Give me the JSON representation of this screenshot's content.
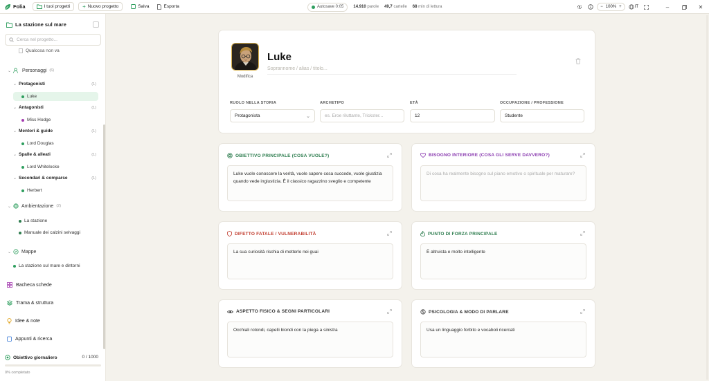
{
  "app": {
    "name": "Folia",
    "accent": "#2e9e5e"
  },
  "toolbar": {
    "my_projects": "I tuoi progetti",
    "new_project": "Nuovo progetto",
    "save": "Salva",
    "export": "Esporta",
    "autosave": "Autosave 0:05",
    "words_value": "14.910",
    "words_label": "parole",
    "pages_value": "49,7",
    "pages_label": "cartelle",
    "read_value": "68",
    "read_label": "min di lettura",
    "zoom": "100%",
    "lang": "IT"
  },
  "sidebar": {
    "project_title": "La stazione sul mare",
    "search_placeholder": "Cerca nel progetto...",
    "top_item": "Qualcosa non va",
    "characters": {
      "label": "Personaggi",
      "count": "(6)"
    },
    "groups": [
      {
        "label": "Protagonisti",
        "count": "(1)",
        "items": [
          {
            "label": "Luke",
            "color": "#2e9e5e"
          }
        ]
      },
      {
        "label": "Antagonisti",
        "count": "(1)",
        "items": [
          {
            "label": "Miss Hodge",
            "color": "#a43bb0"
          }
        ]
      },
      {
        "label": "Mentori & guide",
        "count": "(1)",
        "items": [
          {
            "label": "Lord Douglas",
            "color": "#2e9e5e"
          }
        ]
      },
      {
        "label": "Spalle & alleati",
        "count": "(1)",
        "items": [
          {
            "label": "Lord Whitelocke",
            "color": "#2e9e5e"
          }
        ]
      },
      {
        "label": "Secondari & comparse",
        "count": "(1)",
        "items": [
          {
            "label": "Herbert",
            "color": "#2e9e5e"
          }
        ]
      }
    ],
    "setting": {
      "label": "Ambientazione",
      "count": "(2)",
      "items": [
        "La stazione",
        "Manuale dei calzini selvaggi"
      ]
    },
    "maps": {
      "label": "Mappe",
      "items": [
        "La stazione sul mare e dintorni"
      ]
    },
    "nav": [
      "Bacheca schede",
      "Trama & struttura",
      "Idee & note",
      "Appunti & ricerca"
    ],
    "goal": {
      "label": "Obiettivo giornaliero",
      "value": "0 / 1000",
      "progress": 0,
      "percent_label": "0% completato"
    }
  },
  "character": {
    "name": "Luke",
    "nickname_placeholder": "Soprannome / alias / titolo...",
    "avatar_edit": "Modifica",
    "fields": [
      {
        "label": "RUOLO NELLA STORIA",
        "value": "Protagonista",
        "placeholder": ""
      },
      {
        "label": "ARCHETIPO",
        "value": "",
        "placeholder": "es. Eroe riluttante, Trickster..."
      },
      {
        "label": "ETÀ",
        "value": "12",
        "placeholder": ""
      },
      {
        "label": "OCCUPAZIONE / PROFESSIONE",
        "value": "Studente",
        "placeholder": ""
      }
    ]
  },
  "cards": [
    {
      "title": "OBIETTIVO PRINCIPALE (COSA VUOLE?)",
      "color": "#2e7d4f",
      "icon": "target-icon",
      "text": "Luke vuole conoscere la verità, vuole sapere cosa succede, vuole giustizia quando vede ingiustizia. È il classico ragazzino sveglio e competente",
      "placeholder": ""
    },
    {
      "title": "BISOGNO INTERIORE (COSA GLI SERVE DAVVERO?)",
      "color": "#8a3bb0",
      "icon": "heart-icon",
      "text": "",
      "placeholder": "Di cosa ha realmente bisogno sul piano emotivo o spirituale per maturare?"
    },
    {
      "title": "DIFETTO FATALE / VULNERABILITÀ",
      "color": "#c0392b",
      "icon": "shield-icon",
      "text": "La sua curiosità rischia di metterlo nei guai",
      "placeholder": ""
    },
    {
      "title": "PUNTO DI FORZA PRINCIPALE",
      "color": "#2e7d4f",
      "icon": "flame-icon",
      "text": "È altruista e molto intelligente",
      "placeholder": ""
    },
    {
      "title": "ASPETTO FISICO & SEGNI PARTICOLARI",
      "color": "#333333",
      "icon": "eye-icon",
      "text": "Occhiali rotondi, capelli biondi con la piega a sinistra",
      "placeholder": ""
    },
    {
      "title": "PSICOLOGIA & MODO DI PARLARE",
      "color": "#333333",
      "icon": "brain-icon",
      "text": "Usa un linguaggio forbito e vocaboli ricercati",
      "placeholder": ""
    }
  ]
}
